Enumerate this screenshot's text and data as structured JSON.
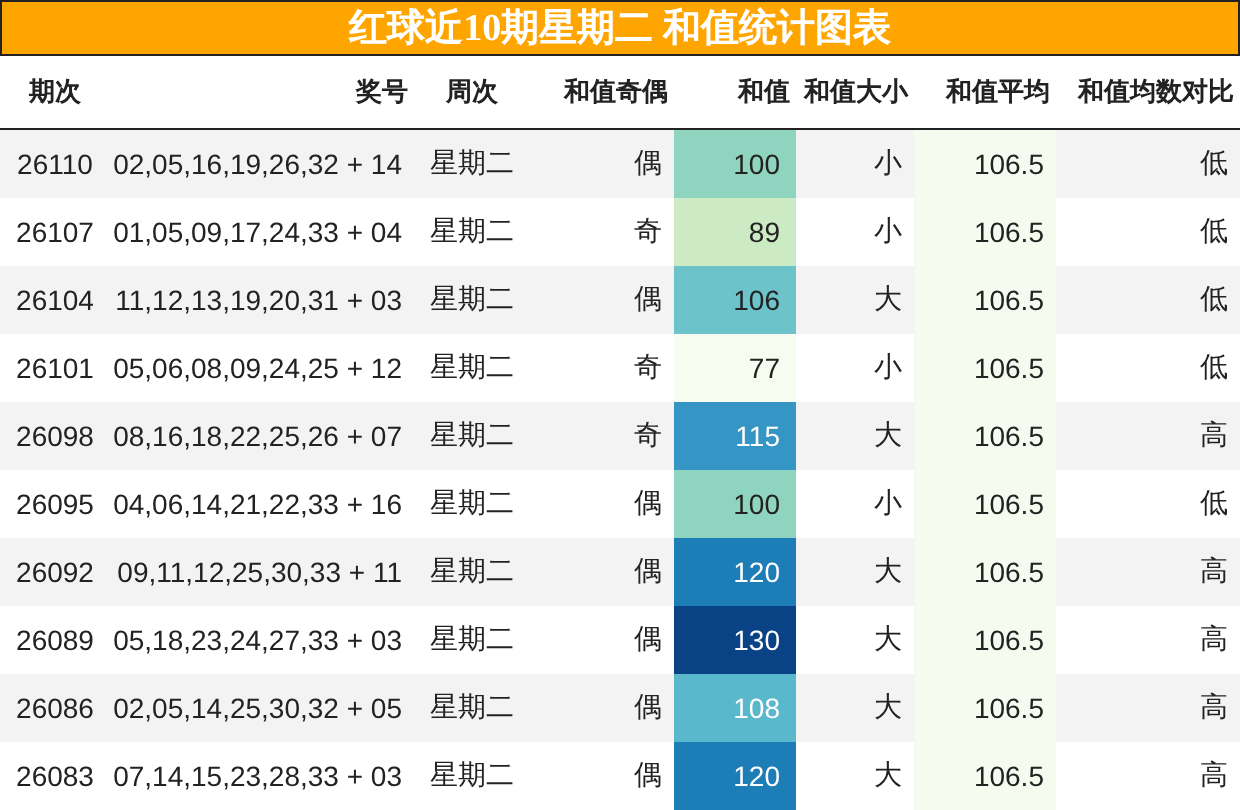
{
  "title": "红球近10期星期二 和值统计图表",
  "columns": [
    "期次",
    "奖号",
    "周次",
    "和值奇偶",
    "和值",
    "和值大小",
    "和值平均",
    "和值均数对比"
  ],
  "rows": [
    {
      "issue": "26110",
      "numbers": "02,05,16,19,26,32 + 14",
      "weekday": "星期二",
      "parity": "偶",
      "sum": "100",
      "color": "#8fd4bf",
      "size": "小",
      "average": "106.5",
      "compare": "低"
    },
    {
      "issue": "26107",
      "numbers": "01,05,09,17,24,33 + 04",
      "weekday": "星期二",
      "parity": "奇",
      "sum": "89",
      "color": "#ccebc5",
      "size": "小",
      "average": "106.5",
      "compare": "低"
    },
    {
      "issue": "26104",
      "numbers": "11,12,13,19,20,31 + 03",
      "weekday": "星期二",
      "parity": "偶",
      "sum": "106",
      "color": "#6cc3c9",
      "size": "大",
      "average": "106.5",
      "compare": "低"
    },
    {
      "issue": "26101",
      "numbers": "05,06,08,09,24,25 + 12",
      "weekday": "星期二",
      "parity": "奇",
      "sum": "77",
      "color": "#f7fcf0",
      "size": "小",
      "average": "106.5",
      "compare": "低"
    },
    {
      "issue": "26098",
      "numbers": "08,16,18,22,25,26 + 07",
      "weekday": "星期二",
      "parity": "奇",
      "sum": "115",
      "color": "#3595c5",
      "size": "大",
      "average": "106.5",
      "compare": "高"
    },
    {
      "issue": "26095",
      "numbers": "04,06,14,21,22,33 + 16",
      "weekday": "星期二",
      "parity": "偶",
      "sum": "100",
      "color": "#8fd4bf",
      "size": "小",
      "average": "106.5",
      "compare": "低"
    },
    {
      "issue": "26092",
      "numbers": "09,11,12,25,30,33 + 11",
      "weekday": "星期二",
      "parity": "偶",
      "sum": "120",
      "color": "#1d7db7",
      "size": "大",
      "average": "106.5",
      "compare": "高"
    },
    {
      "issue": "26089",
      "numbers": "05,18,23,24,27,33 + 03",
      "weekday": "星期二",
      "parity": "偶",
      "sum": "130",
      "color": "#0a4286",
      "size": "大",
      "average": "106.5",
      "compare": "高"
    },
    {
      "issue": "26086",
      "numbers": "02,05,14,25,30,32 + 05",
      "weekday": "星期二",
      "parity": "偶",
      "sum": "108",
      "color": "#5ab8cd",
      "size": "大",
      "average": "106.5",
      "compare": "高"
    },
    {
      "issue": "26083",
      "numbers": "07,14,15,23,28,33 + 03",
      "weekday": "星期二",
      "parity": "偶",
      "sum": "120",
      "color": "#1d7db7",
      "size": "大",
      "average": "106.5",
      "compare": "高"
    }
  ]
}
